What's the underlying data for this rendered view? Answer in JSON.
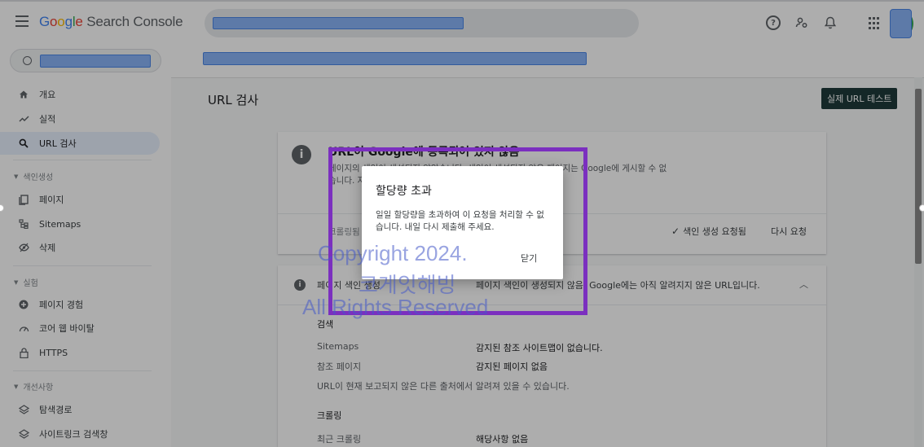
{
  "header": {
    "logo": {
      "G": "G",
      "o1": "o",
      "o2": "o",
      "g": "g",
      "l": "l",
      "e": "e",
      "product": "Search Console"
    }
  },
  "sidebar": {
    "items": [
      {
        "label": "개요",
        "icon": "home-icon"
      },
      {
        "label": "실적",
        "icon": "trending-icon"
      },
      {
        "label": "URL 검사",
        "icon": "search-icon",
        "active": true
      },
      {
        "label": "페이지",
        "icon": "pages-icon"
      },
      {
        "label": "Sitemaps",
        "icon": "sitemap-icon"
      },
      {
        "label": "삭제",
        "icon": "hidden-eye-icon"
      },
      {
        "label": "페이지 경험",
        "icon": "plus-circle-icon"
      },
      {
        "label": "코어 웹 바이탈",
        "icon": "gauge-icon"
      },
      {
        "label": "HTTPS",
        "icon": "lock-icon"
      },
      {
        "label": "탐색경로",
        "icon": "layers-icon"
      },
      {
        "label": "사이트링크 검색창",
        "icon": "layers-icon"
      }
    ],
    "sections": [
      "색인생성",
      "실험",
      "개선사항"
    ]
  },
  "main": {
    "title": "URL 검사",
    "live_test_label": "실제 URL 테스트",
    "status_card": {
      "heading": "URL이 Google에 등록되어 있지 않음",
      "desc": "페이지의 색인이 생성되지 않았습니다. 색인이 생성되지 않은 페이지는 Google에 게시할 수 없습니다. 자세히 알아보려면 아래의 세부정보를 참고하세요.",
      "crawl_label": "크롤링됨",
      "requested_label": "색인 생성 요청됨",
      "rerequest_label": "다시 요청"
    },
    "detail_card": {
      "row_label": "페이지 색인 생성",
      "row_value": "페이지 색인이 생성되지 않음: Google에는 아직 알려지지 않은 URL입니다.",
      "section_search": "검색",
      "sitemaps_key": "Sitemaps",
      "sitemaps_value": "감지된 참조 사이트맵이 없습니다.",
      "ref_key": "참조 페이지",
      "ref_value": "감지된 페이지 없음",
      "note": "URL이 현재 보고되지 않은 다른 출처에서 알려져 있을 수 있습니다.",
      "section_crawl": "크롤링",
      "last_crawl_key": "최근 크롤링",
      "last_crawl_value": "해당사항 없음"
    }
  },
  "dialog": {
    "title": "할당량 초과",
    "message": "일일 할당량을 초과하여 이 요청을 처리할 수 없습니다. 내일 다시 제출해 주세요.",
    "close_label": "닫기"
  },
  "watermark": {
    "line1": "Copyright 2024.",
    "line2": "코게잇해빙",
    "line3": "All Rights Reserved"
  },
  "colors": {
    "accent": "#1a73e8",
    "highlight_box": "#7b2fbf",
    "live_test_bg": "#1e3a3a"
  }
}
